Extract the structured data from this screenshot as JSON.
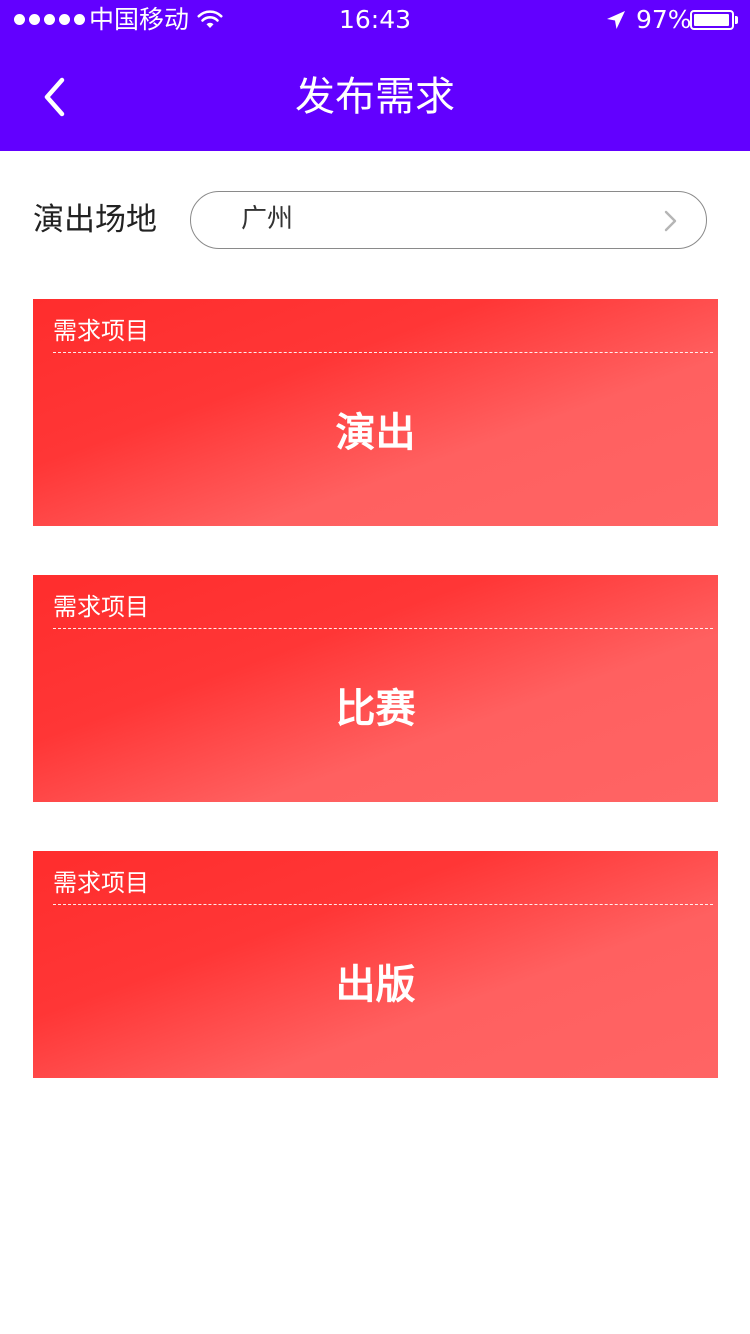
{
  "status_bar": {
    "carrier": "中国移动",
    "time": "16:43",
    "battery_percent": "97%",
    "battery_level": 0.97,
    "signal_bars": 5,
    "icons": [
      "wifi-icon",
      "location-arrow-icon",
      "battery-icon"
    ]
  },
  "nav": {
    "title": "发布需求",
    "back_icon": "chevron-left-icon"
  },
  "venue": {
    "label": "演出场地",
    "value": "广州",
    "chevron_icon": "chevron-right-icon"
  },
  "cards": [
    {
      "caption": "需求项目",
      "title": "演出"
    },
    {
      "caption": "需求项目",
      "title": "比赛"
    },
    {
      "caption": "需求项目",
      "title": "出版"
    }
  ],
  "colors": {
    "header_bg": "#6200ff",
    "card_gradient_start": "#ff2d2d",
    "card_gradient_end": "#ff6464",
    "text_primary": "#222222"
  }
}
